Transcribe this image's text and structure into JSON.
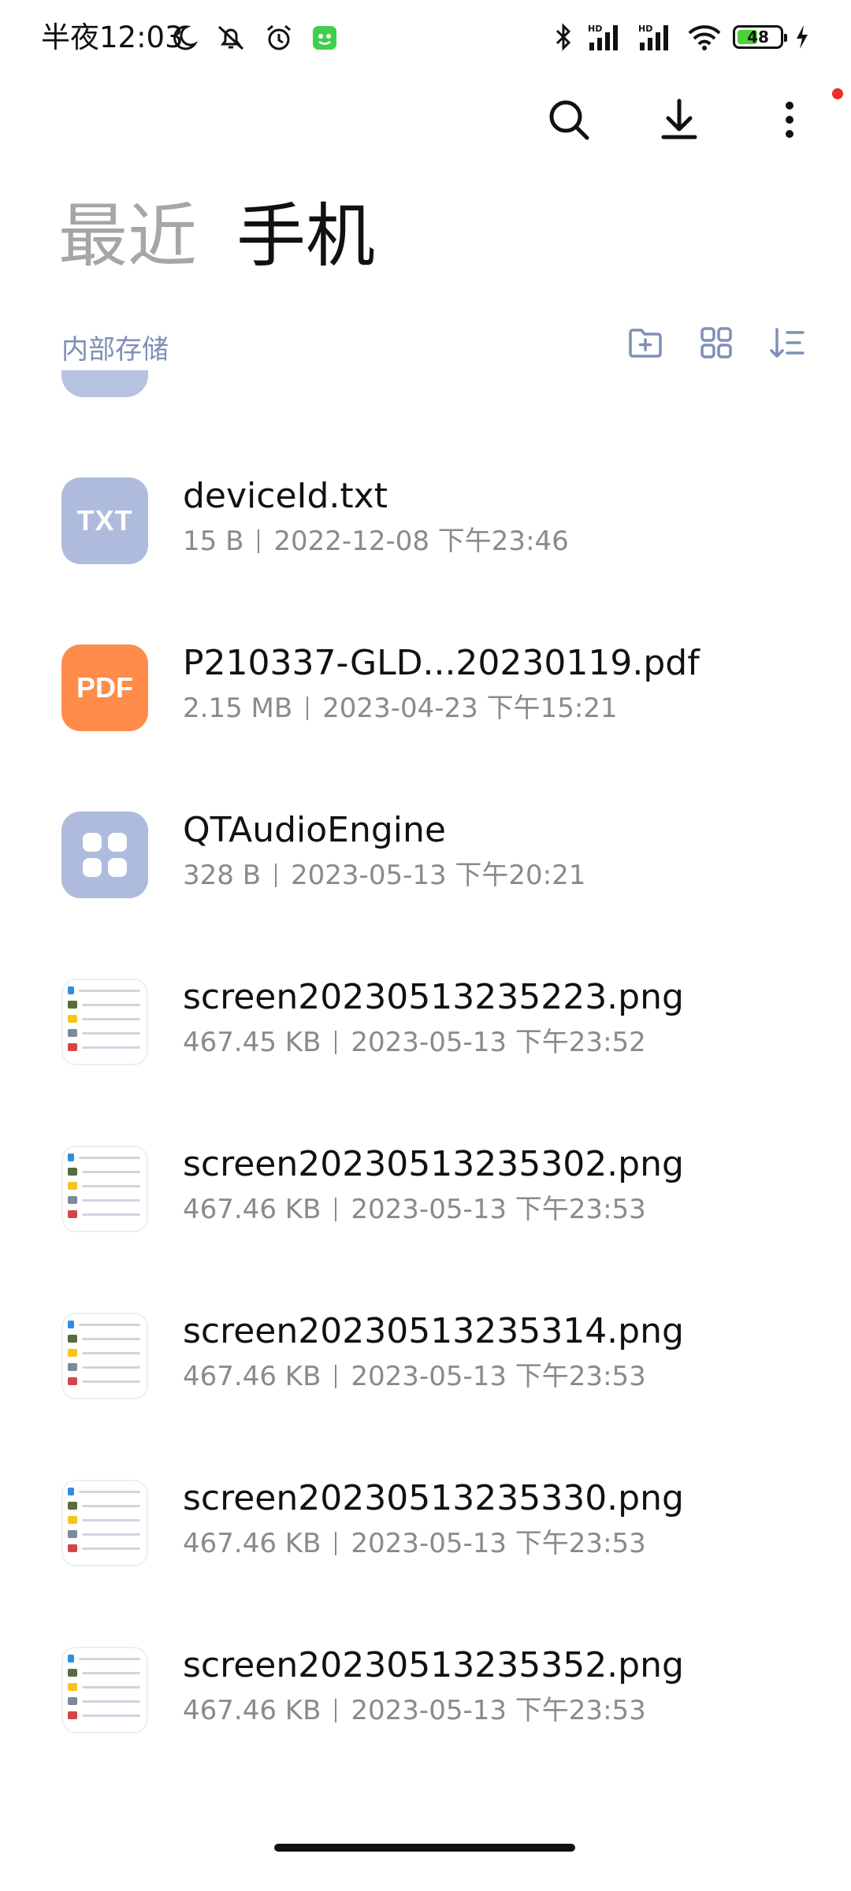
{
  "status_bar": {
    "time": "半夜12:03",
    "battery": "48",
    "battery_level": 0.48,
    "icons_left": [
      "moon-icon",
      "bell-off-icon",
      "alarm-icon",
      "app-notify-icon"
    ],
    "icons_right": [
      "bluetooth-icon",
      "signal-hd-icon",
      "signal-hd-icon",
      "wifi-icon",
      "battery-icon",
      "charging-icon"
    ],
    "hd_label": "HD"
  },
  "toolbar": {
    "actions": [
      "search-icon",
      "download-icon",
      "more-icon"
    ]
  },
  "tabs": [
    {
      "label": "最近",
      "active": false
    },
    {
      "label": "手机",
      "active": true
    }
  ],
  "location": {
    "label": "内部存储",
    "tools": [
      "new-folder-icon",
      "grid-view-icon",
      "sort-icon"
    ]
  },
  "files": [
    {
      "name": "deviceId.txt",
      "size": "15 B",
      "date": "2022-12-08 下午23:46",
      "type": "txt",
      "icon_text": "TXT"
    },
    {
      "name": "P210337-GLD...20230119.pdf",
      "size": "2.15 MB",
      "date": "2023-04-23 下午15:21",
      "type": "pdf",
      "icon_text": "PDF"
    },
    {
      "name": "QTAudioEngine",
      "size": "328 B",
      "date": "2023-05-13 下午20:21",
      "type": "app",
      "icon_text": ""
    },
    {
      "name": "screen20230513235223.png",
      "size": "467.45 KB",
      "date": "2023-05-13 下午23:52",
      "type": "image",
      "icon_text": ""
    },
    {
      "name": "screen20230513235302.png",
      "size": "467.46 KB",
      "date": "2023-05-13 下午23:53",
      "type": "image",
      "icon_text": ""
    },
    {
      "name": "screen20230513235314.png",
      "size": "467.46 KB",
      "date": "2023-05-13 下午23:53",
      "type": "image",
      "icon_text": ""
    },
    {
      "name": "screen20230513235330.png",
      "size": "467.46 KB",
      "date": "2023-05-13 下午23:53",
      "type": "image",
      "icon_text": ""
    },
    {
      "name": "screen20230513235352.png",
      "size": "467.46 KB",
      "date": "2023-05-13 下午23:53",
      "type": "image",
      "icon_text": ""
    }
  ],
  "colors": {
    "accent_label": "#7f8fb6",
    "txt_icon": "#aebbdc",
    "pdf_icon": "#ff8c4a",
    "notification_dot": "#f02d2d",
    "battery_fill": "#4cd137"
  }
}
